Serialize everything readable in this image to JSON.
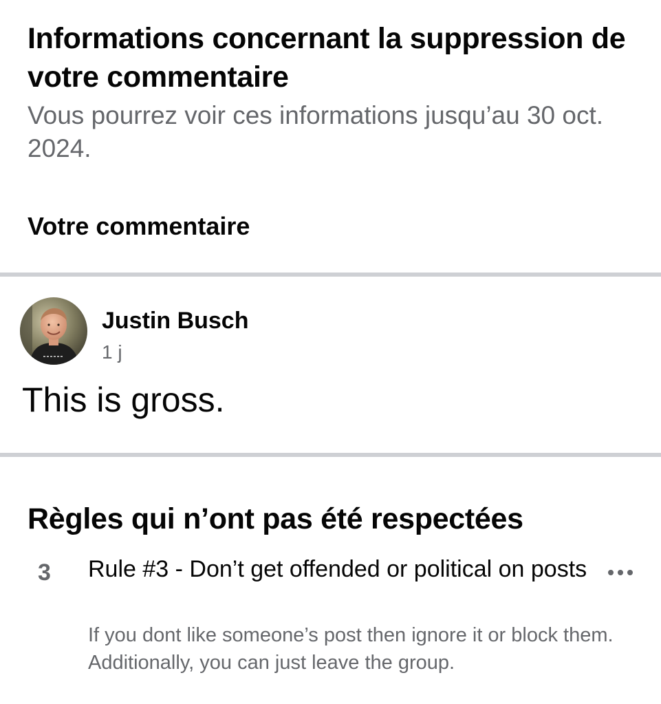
{
  "header": {
    "title": "Informations concernant la suppression de votre commentaire",
    "subtitle": "Vous pourrez voir ces informations jusqu’au 30 oct. 2024."
  },
  "comment_section": {
    "label": "Votre commentaire",
    "author": "Justin Busch",
    "time": "1 j",
    "text": "This is gross."
  },
  "rules_section": {
    "title": "Règles qui n’ont pas été respectées",
    "rules": [
      {
        "number": "3",
        "title": "Rule #3 - Don’t get offended or political on posts",
        "description": "If you dont like someone’s post then ignore it or block them. Additionally, you can just leave the group.",
        "more_icon": "more-horizontal-icon"
      }
    ]
  },
  "colors": {
    "primary_text": "#050505",
    "secondary_text": "#65676b",
    "divider": "#ced0d4",
    "background": "#ffffff"
  }
}
